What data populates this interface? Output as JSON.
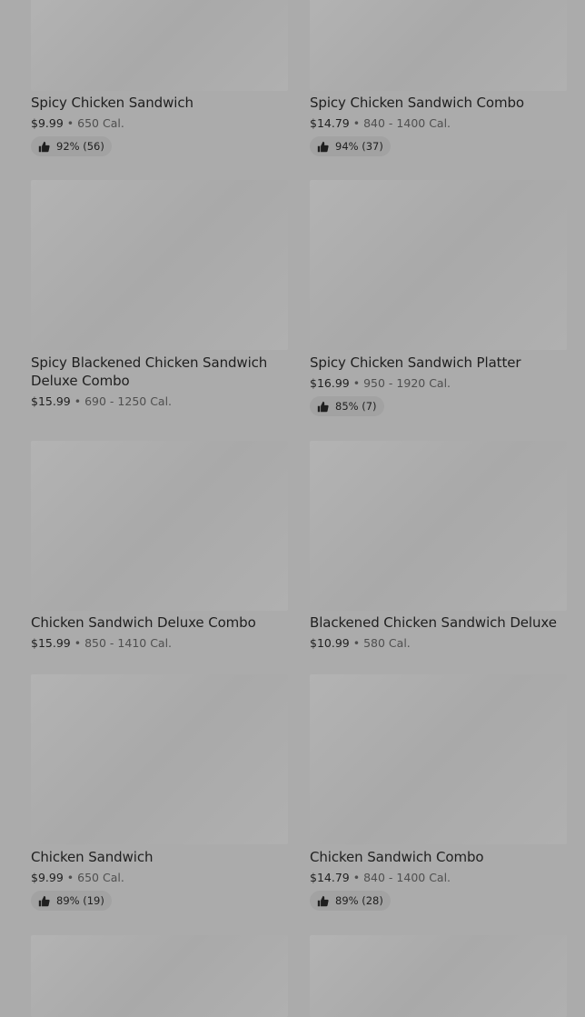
{
  "menu_items": [
    {
      "name": "Spicy Chicken Sandwich",
      "price": "$9.99",
      "calories": "650 Cal.",
      "rating": "92% (56)"
    },
    {
      "name": "Spicy Chicken Sandwich Combo",
      "price": "$14.79",
      "calories": "840 - 1400 Cal.",
      "rating": "94% (37)"
    },
    {
      "name_line1": "Spicy Blackened Chicken Sandwich",
      "name_line2": "Deluxe Combo",
      "price": "$15.99",
      "calories": "690 - 1250 Cal."
    },
    {
      "name": "Spicy Chicken Sandwich Platter",
      "price": "$16.99",
      "calories": "950 - 1920 Cal.",
      "rating": "85% (7)"
    },
    {
      "name": "Chicken Sandwich Deluxe Combo",
      "price": "$15.99",
      "calories": "850 - 1410 Cal."
    },
    {
      "name": "Blackened Chicken Sandwich Deluxe",
      "price": "$10.99",
      "calories": "580 Cal."
    },
    {
      "name": "Chicken Sandwich",
      "price": "$9.99",
      "calories": "650 Cal.",
      "rating": "89% (19)"
    },
    {
      "name": "Chicken Sandwich Combo",
      "price": "$14.79",
      "calories": "840 - 1400 Cal.",
      "rating": "89% (28)"
    }
  ],
  "separator": "•",
  "icons": {
    "rating": "thumbs-up-icon"
  }
}
